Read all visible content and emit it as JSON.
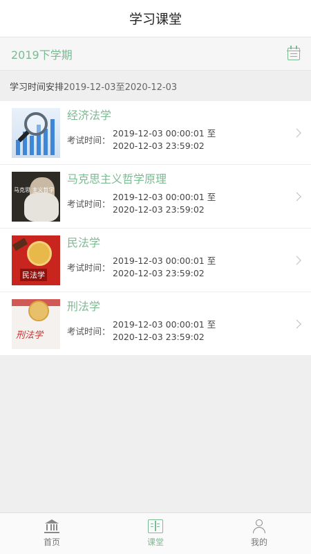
{
  "header": {
    "title": "学习课堂"
  },
  "semester": {
    "label": "2019下学期",
    "icon": "calendar-icon"
  },
  "schedule": {
    "label": "学习时间安排",
    "dates": "2019-12-03至2020-12-03"
  },
  "courses": [
    {
      "name": "经济法学",
      "exam_label": "考试时间：",
      "start": "2019-12-03 00:00:01 至",
      "end": "2020-12-03 23:59:02"
    },
    {
      "name": "马克思主义哲学原理",
      "exam_label": "考试时间：",
      "start": "2019-12-03 00:00:01 至",
      "end": "2020-12-03 23:59:02",
      "thumb_text": "马克思 主义哲学"
    },
    {
      "name": "民法学",
      "exam_label": "考试时间：",
      "start": "2019-12-03 00:00:01 至",
      "end": "2020-12-03 23:59:02",
      "thumb_text": "民法学"
    },
    {
      "name": "刑法学",
      "exam_label": "考试时间：",
      "start": "2019-12-03 00:00:01 至",
      "end": "2020-12-03 23:59:02",
      "thumb_text": "刑法学"
    }
  ],
  "tabbar": {
    "tabs": [
      {
        "label": "首页",
        "icon": "home-icon",
        "active": false
      },
      {
        "label": "课堂",
        "icon": "book-icon",
        "active": true
      },
      {
        "label": "我的",
        "icon": "user-icon",
        "active": false
      }
    ]
  },
  "colors": {
    "accent": "#7cba92",
    "background": "#efefef"
  }
}
